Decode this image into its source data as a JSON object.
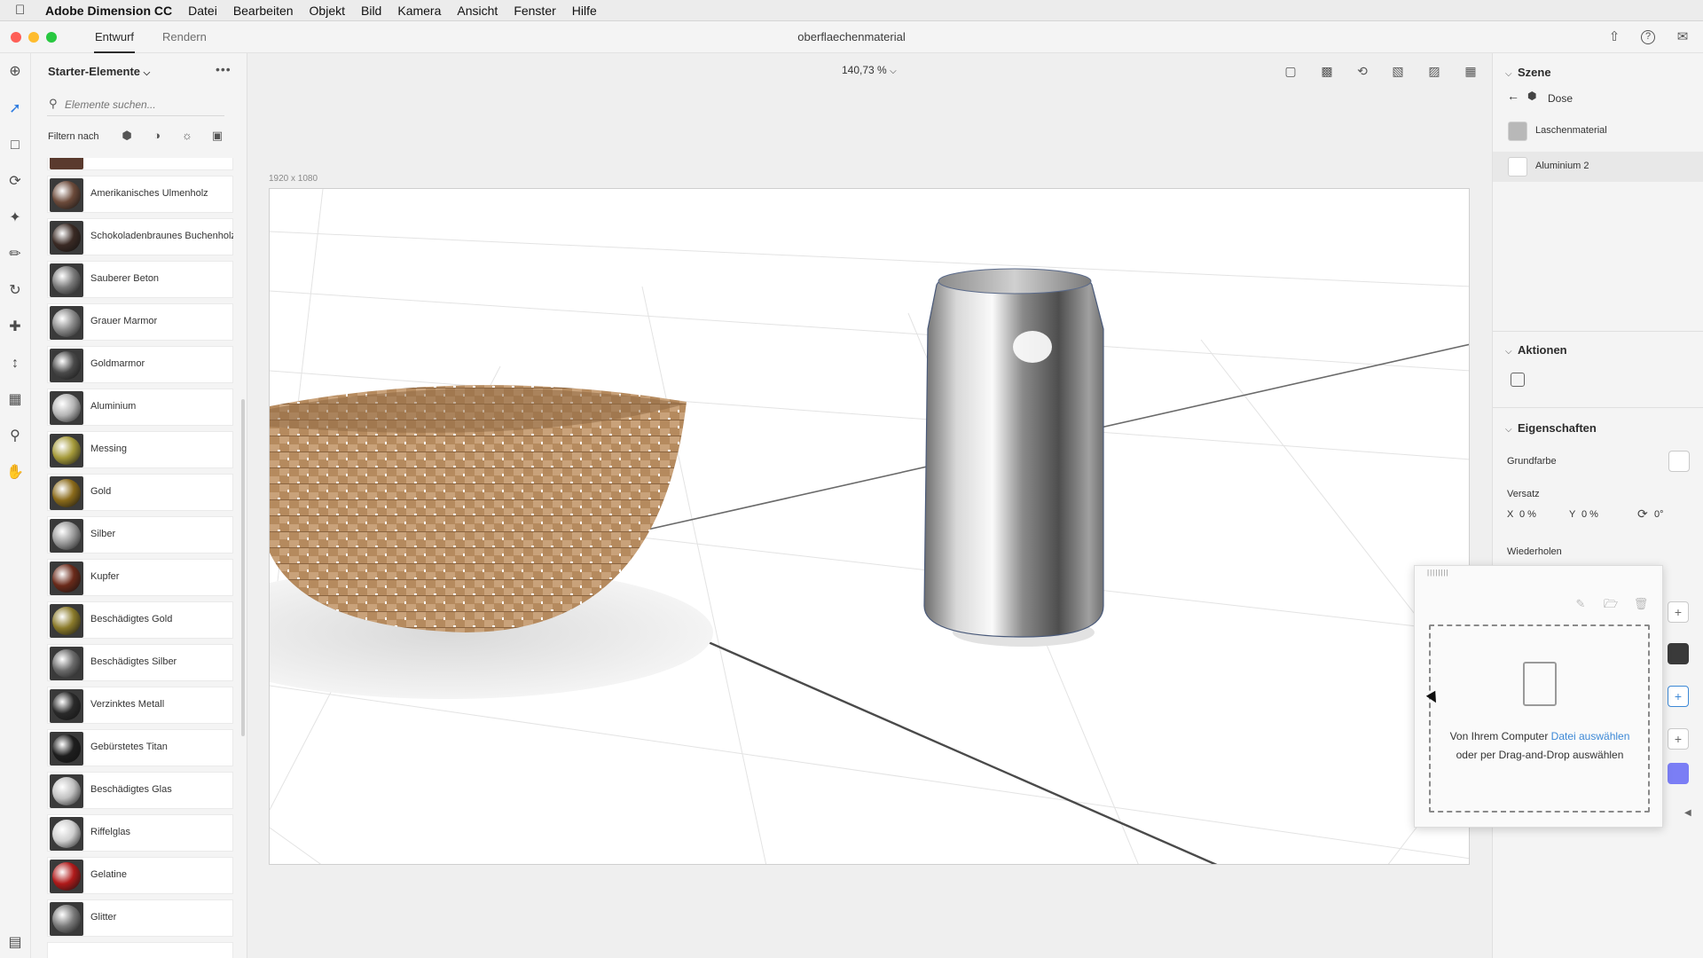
{
  "menubar": {
    "app_name": "Adobe Dimension CC",
    "items": [
      "Datei",
      "Bearbeiten",
      "Objekt",
      "Bild",
      "Kamera",
      "Ansicht",
      "Fenster",
      "Hilfe"
    ]
  },
  "titlebar": {
    "tabs": [
      "Entwurf",
      "Rendern"
    ],
    "active_tab": "Entwurf",
    "document_title": "oberflaechenmaterial"
  },
  "assets": {
    "title": "Starter-Elemente",
    "search_placeholder": "Elemente suchen...",
    "filter_label": "Filtern nach",
    "items": [
      {
        "label": "Amerikanisches Ulmenholz",
        "color": "#6b4a3a"
      },
      {
        "label": "Schokoladenbraunes Buchenholz",
        "color": "#3a2a24"
      },
      {
        "label": "Sauberer Beton",
        "color": "#7a7a7a"
      },
      {
        "label": "Grauer Marmor",
        "color": "#8a8a8a"
      },
      {
        "label": "Goldmarmor",
        "color": "#4a4a4a"
      },
      {
        "label": "Aluminium",
        "color": "#b5b5b5"
      },
      {
        "label": "Messing",
        "color": "#a59a3a"
      },
      {
        "label": "Gold",
        "color": "#8a6a1a"
      },
      {
        "label": "Silber",
        "color": "#9a9a9a"
      },
      {
        "label": "Kupfer",
        "color": "#6a2a1a"
      },
      {
        "label": "Beschädigtes Gold",
        "color": "#8a7a2a"
      },
      {
        "label": "Beschädigtes Silber",
        "color": "#6a6a6a"
      },
      {
        "label": "Verzinktes Metall",
        "color": "#2a2a2a"
      },
      {
        "label": "Gebürstetes Titan",
        "color": "#1e1e1e"
      },
      {
        "label": "Beschädigtes Glas",
        "color": "#c0c0c0"
      },
      {
        "label": "Riffelglas",
        "color": "#cfcfcf"
      },
      {
        "label": "Gelatine",
        "color": "#b01a1a"
      },
      {
        "label": "Glitter",
        "color": "#7a7a7a"
      }
    ]
  },
  "canvas": {
    "zoom": "140,73 %",
    "dimensions": "1920 x 1080"
  },
  "rightpanel": {
    "scene_title": "Szene",
    "breadcrumb": "Dose",
    "layers": [
      {
        "label": "Laschenmaterial",
        "color": "#b8b8b8"
      },
      {
        "label": "Aluminium 2",
        "color": "#ffffff"
      }
    ],
    "actions_title": "Aktionen",
    "properties_title": "Eigenschaften",
    "base_color_label": "Grundfarbe",
    "offset_label": "Versatz",
    "offset_x_label": "X",
    "offset_x_value": "0 %",
    "offset_y_label": "Y",
    "offset_y_value": "0 %",
    "rotation_value": "0°",
    "repeat_label": "Wiederholen"
  },
  "popup": {
    "drop_text_before": "Von Ihrem Computer ",
    "drop_link": "Datei auswählen",
    "drop_text_after": " oder per Drag-and-Drop auswählen"
  },
  "colors": {
    "accent_link": "#3c88d6",
    "dark_swatch": "#3a3a3a",
    "purple_swatch": "#7b7ef5"
  }
}
